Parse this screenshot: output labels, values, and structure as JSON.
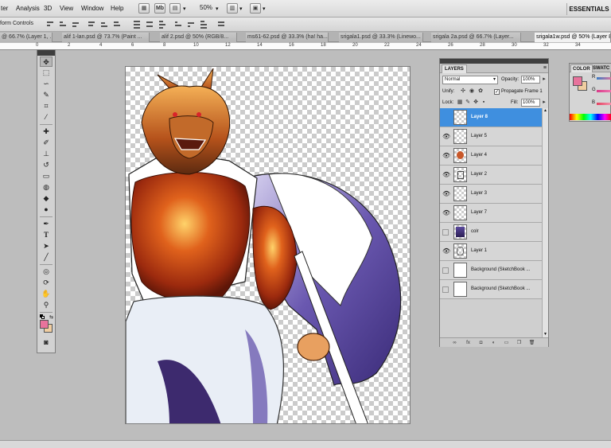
{
  "menu": [
    "ter",
    "Analysis",
    "3D",
    "View",
    "Window",
    "Help"
  ],
  "app_bar": {
    "mb_label": "Mb",
    "zoom": "50%",
    "workspace": "ESSENTIALS"
  },
  "options_bar": {
    "label": "form Controls"
  },
  "document_tabs": [
    {
      "label": "@ 66.7% (Layer 1, ..."
    },
    {
      "label": "alif 1-lan.psd @ 73.7% (Paint ..."
    },
    {
      "label": "alif 2.psd @ 50% (RGB/8..."
    },
    {
      "label": "ms61-62.psd @ 33.3% (ha! ha..."
    },
    {
      "label": "srigala1.psd @ 33.3% (Linewo..."
    },
    {
      "label": "srigala 2a.psd @ 66.7% (Layer..."
    },
    {
      "label": "srigala1w.psd @ 50% (Layer 8"
    }
  ],
  "ruler_numbers": [
    "0",
    "2",
    "4",
    "6",
    "8",
    "10",
    "12",
    "14",
    "16",
    "18",
    "20",
    "22",
    "24",
    "26",
    "28",
    "30",
    "32",
    "34"
  ],
  "toolbox": {
    "collapse_label": "◂◂ ×"
  },
  "layers_panel": {
    "tab": "LAYERS",
    "blend_mode": "Normal",
    "opacity_label": "Opacity:",
    "opacity": "100%",
    "unify_label": "Unify:",
    "propagate_label": "Propagate Frame 1",
    "lock_label": "Lock:",
    "fill_label": "Fill:",
    "fill": "100%",
    "layers": [
      {
        "name": "Layer 8",
        "visible": false,
        "selected": true,
        "thumb": "checker"
      },
      {
        "name": "Layer 5",
        "visible": true,
        "selected": false,
        "thumb": "checker"
      },
      {
        "name": "Layer 4",
        "visible": true,
        "selected": false,
        "thumb": "art"
      },
      {
        "name": "Layer 2",
        "visible": true,
        "selected": false,
        "thumb": "art"
      },
      {
        "name": "Layer 3",
        "visible": true,
        "selected": false,
        "thumb": "checker"
      },
      {
        "name": "Layer 7",
        "visible": true,
        "selected": false,
        "thumb": "checker"
      },
      {
        "name": "colr",
        "visible": false,
        "selected": false,
        "thumb": "art"
      },
      {
        "name": "Layer 1",
        "visible": true,
        "selected": false,
        "thumb": "art"
      },
      {
        "name": "Background (SketchBook ...",
        "visible": false,
        "selected": false,
        "thumb": "white"
      },
      {
        "name": "Background (SketchBook ...",
        "visible": false,
        "selected": false,
        "thumb": "white"
      }
    ]
  },
  "color_panel": {
    "tabs": [
      "COLOR",
      "SWATC"
    ],
    "labels": {
      "r": "R",
      "g": "G",
      "b": "B"
    }
  },
  "colors": {
    "foreground": "#e8739c",
    "background": "#f0cda0",
    "selection": "#3f8fdf"
  }
}
